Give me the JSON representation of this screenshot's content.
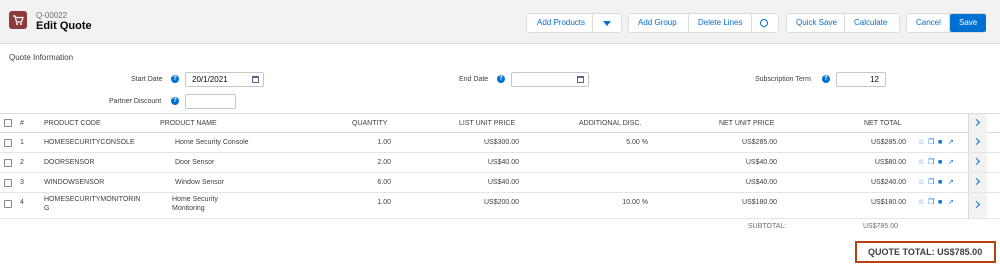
{
  "header": {
    "record_number": "Q-00022",
    "title": "Edit Quote",
    "buttons": {
      "add_products": "Add Products",
      "add_group": "Add Group",
      "delete_lines": "Delete Lines",
      "quick_save": "Quick Save",
      "calculate": "Calculate",
      "cancel": "Cancel",
      "save": "Save"
    }
  },
  "quote_info": {
    "section_title": "Quote Information",
    "start_date_label": "Start Date",
    "start_date_value": "20/1/2021",
    "end_date_label": "End Date",
    "end_date_value": "",
    "subscription_term_label": "Subscription Term",
    "subscription_term_value": "12",
    "partner_discount_label": "Partner Discount",
    "partner_discount_value": ""
  },
  "table": {
    "columns": [
      "#",
      "PRODUCT CODE",
      "PRODUCT NAME",
      "QUANTITY",
      "LIST UNIT PRICE",
      "ADDITIONAL DISC.",
      "NET UNIT PRICE",
      "NET TOTAL"
    ],
    "rows": [
      {
        "num": "1",
        "code": "HOMESECURITYCONSOLE",
        "name": "Home Security Console",
        "qty": "1.00",
        "list": "US$300.00",
        "disc": "5.00 %",
        "net_unit": "US$285.00",
        "net_total": "US$285.00"
      },
      {
        "num": "2",
        "code": "DOORSENSOR",
        "name": "Door Sensor",
        "qty": "2.00",
        "list": "US$40.00",
        "disc": "",
        "net_unit": "US$40.00",
        "net_total": "US$80.00"
      },
      {
        "num": "3",
        "code": "WINDOWSENSOR",
        "name": "Window Sensor",
        "qty": "6.00",
        "list": "US$40.00",
        "disc": "",
        "net_unit": "US$40.00",
        "net_total": "US$240.00"
      },
      {
        "num": "4",
        "code_line1": "HOMESECURITYMONITORIN",
        "code_line2": "G",
        "name_line1": "Home Security",
        "name_line2": "Monitoring",
        "qty": "1.00",
        "list": "US$200.00",
        "disc": "10.00 %",
        "net_unit": "US$180.00",
        "net_total": "US$180.00"
      }
    ],
    "subtotal_label": "SUBTOTAL:",
    "subtotal_value": "US$785.00"
  },
  "quote_total": "QUOTE TOTAL: US$785.00",
  "colors": {
    "brand": "#0070d2",
    "header_bg": "#f3f2f2",
    "quote_icon": "#8e3b3b",
    "total_highlight": "#b7410e"
  }
}
